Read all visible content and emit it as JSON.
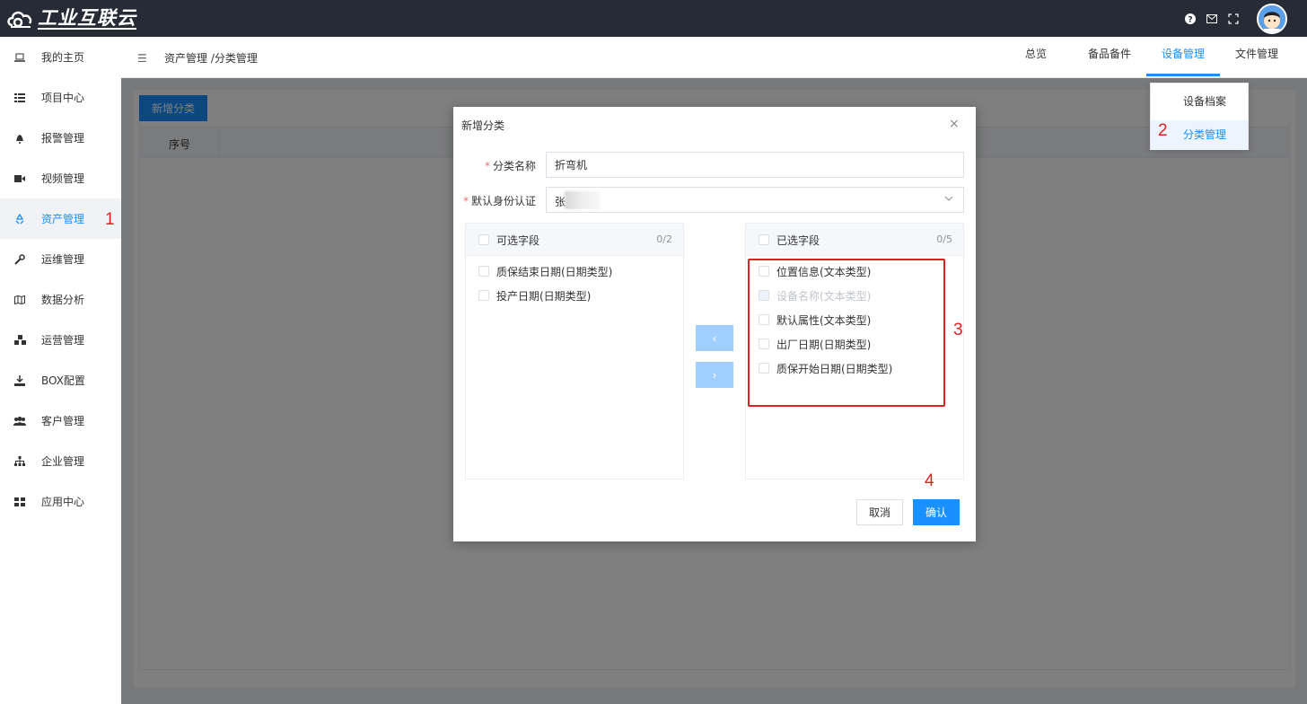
{
  "app": {
    "logo_text": "工业互联云"
  },
  "top_icons": [
    "question-icon",
    "mail-icon",
    "fullscreen-icon"
  ],
  "sidebar": {
    "items": [
      {
        "label": "我的主页",
        "icon": "laptop-icon"
      },
      {
        "label": "项目中心",
        "icon": "list-icon"
      },
      {
        "label": "报警管理",
        "icon": "bell-icon"
      },
      {
        "label": "视频管理",
        "icon": "video-icon"
      },
      {
        "label": "资产管理",
        "icon": "recycle-icon",
        "active": true
      },
      {
        "label": "运维管理",
        "icon": "wrench-icon"
      },
      {
        "label": "数据分析",
        "icon": "map-icon"
      },
      {
        "label": "运营管理",
        "icon": "cubes-icon"
      },
      {
        "label": "BOX配置",
        "icon": "download-icon"
      },
      {
        "label": "客户管理",
        "icon": "users-icon"
      },
      {
        "label": "企业管理",
        "icon": "sitemap-icon"
      },
      {
        "label": "应用中心",
        "icon": "grid-icon"
      }
    ]
  },
  "header": {
    "breadcrumb": "资产管理 /分类管理",
    "tabs": [
      {
        "label": "总览"
      },
      {
        "label": "备品备件"
      },
      {
        "label": "设备管理",
        "active": true
      },
      {
        "label": "文件管理"
      }
    ]
  },
  "dropdown": {
    "items": [
      {
        "label": "设备档案"
      },
      {
        "label": "分类管理",
        "active": true
      }
    ]
  },
  "content": {
    "new_button": "新增分类",
    "column_header": "序号"
  },
  "dialog": {
    "title": "新增分类",
    "close": "×",
    "name_label": "分类名称",
    "name_value": "折弯机",
    "auth_label": "默认身份认证",
    "auth_value": "张",
    "required_mark": "*",
    "left_panel": {
      "title": "可选字段",
      "count": "0/2",
      "items": [
        "质保结束日期(日期类型)",
        "投产日期(日期类型)"
      ]
    },
    "right_panel": {
      "title": "已选字段",
      "count": "0/5",
      "items": [
        {
          "label": "位置信息(文本类型)",
          "disabled": false
        },
        {
          "label": "设备名称(文本类型)",
          "disabled": true
        },
        {
          "label": "默认属性(文本类型)",
          "disabled": false
        },
        {
          "label": "出厂日期(日期类型)",
          "disabled": false
        },
        {
          "label": "质保开始日期(日期类型)",
          "disabled": false
        }
      ]
    },
    "move_left": "‹",
    "move_right": "›",
    "cancel": "取消",
    "confirm": "确认"
  },
  "annotations": [
    "1",
    "2",
    "3",
    "4"
  ],
  "colors": {
    "topbar": "#262b36",
    "primary": "#1890ff",
    "annotation": "#e02020"
  }
}
